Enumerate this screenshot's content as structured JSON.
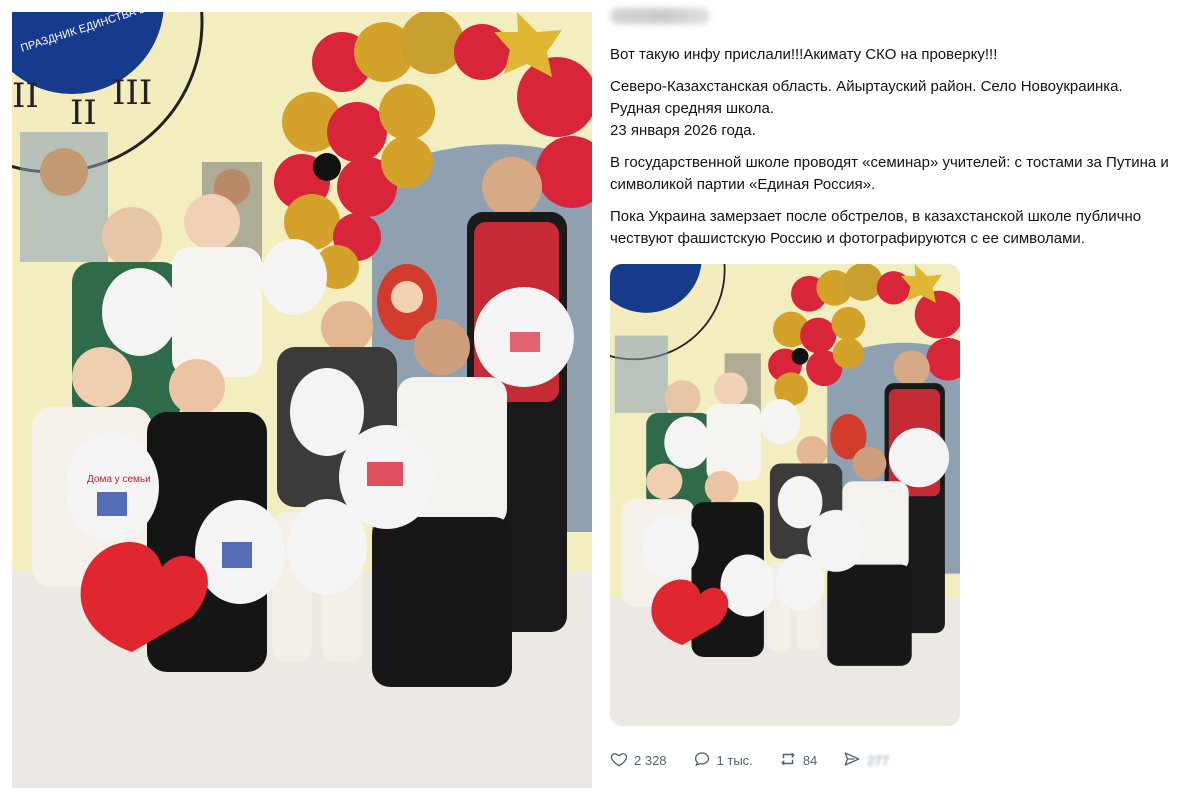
{
  "post": {
    "paragraphs": [
      "Вот такую инфу прислали!!!Акимату СКО на проверку!!!",
      "Северо-Казахстанская область. Айыртауский район. Село Новоукраинка.",
      "Рудная средняя школа.",
      "23 января 2026 года.",
      "В государственной школе проводят «семинар» учителей: с тостами за Путина и символикой партии «Единая Россия».",
      "Пока Украина замерзает после обстрелов, в казахстанской школе публично чествуют фашистскую Россию и фотографируются с ее символами."
    ],
    "actions": {
      "likes": "2 328",
      "replies": "1 тыс.",
      "reposts": "84",
      "views": "277"
    }
  },
  "photo": {
    "banner_text": "ПРАЗДНИК ЕДИНСТВА В КАЖДОЙ СЕМЬЕ",
    "balloon_print": "Дома у семьи",
    "colors": {
      "gold": "#d4a22a",
      "red": "#d9253a",
      "white_balloon": "#f4f4f4",
      "wall": "#f3eebf",
      "clock_blue": "#173b8c"
    }
  }
}
